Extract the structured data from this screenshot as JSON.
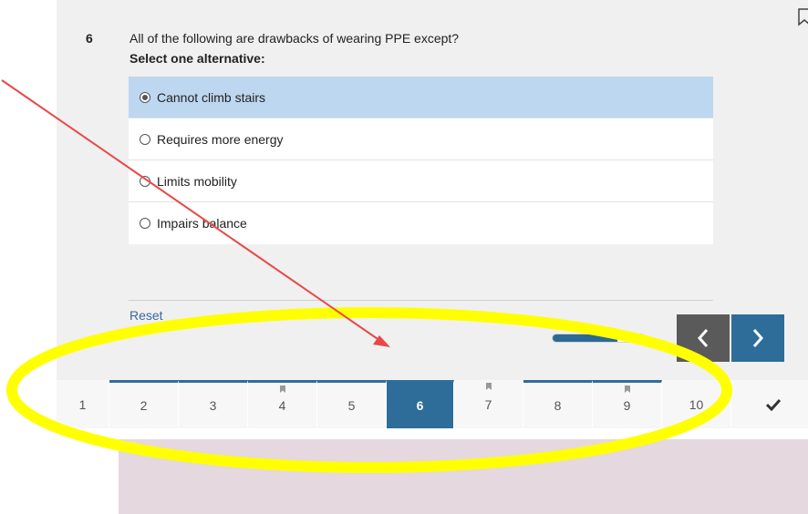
{
  "question": {
    "number": "6",
    "text": "All of the following are drawbacks of wearing PPE except?",
    "instruction": "Select one alternative:",
    "options": [
      {
        "label": "Cannot climb stairs",
        "selected": true
      },
      {
        "label": "Requires more energy",
        "selected": false
      },
      {
        "label": "Limits mobility",
        "selected": false
      },
      {
        "label": "Impairs balance",
        "selected": false
      }
    ]
  },
  "footer": {
    "reset_label": "Reset",
    "progress": 0.7
  },
  "question_nav": [
    {
      "label": "1",
      "answered": false,
      "flagged": false,
      "current": false
    },
    {
      "label": "2",
      "answered": true,
      "flagged": false,
      "current": false
    },
    {
      "label": "3",
      "answered": true,
      "flagged": false,
      "current": false
    },
    {
      "label": "4",
      "answered": true,
      "flagged": true,
      "current": false
    },
    {
      "label": "5",
      "answered": true,
      "flagged": false,
      "current": false
    },
    {
      "label": "6",
      "answered": true,
      "flagged": false,
      "current": true
    },
    {
      "label": "7",
      "answered": false,
      "flagged": true,
      "current": false
    },
    {
      "label": "8",
      "answered": true,
      "flagged": false,
      "current": false
    },
    {
      "label": "9",
      "answered": true,
      "flagged": true,
      "current": false
    },
    {
      "label": "10",
      "answered": false,
      "flagged": false,
      "current": false
    }
  ],
  "icons": {
    "bookmark": "bookmark-icon",
    "prev": "chevron-left-icon",
    "next": "chevron-right-icon",
    "finish": "checkmark-icon"
  },
  "colors": {
    "accent": "#2e6d99",
    "selected_option": "#bcd7ef",
    "highlight_ellipse": "#ffff00",
    "arrow": "#e8484a"
  }
}
